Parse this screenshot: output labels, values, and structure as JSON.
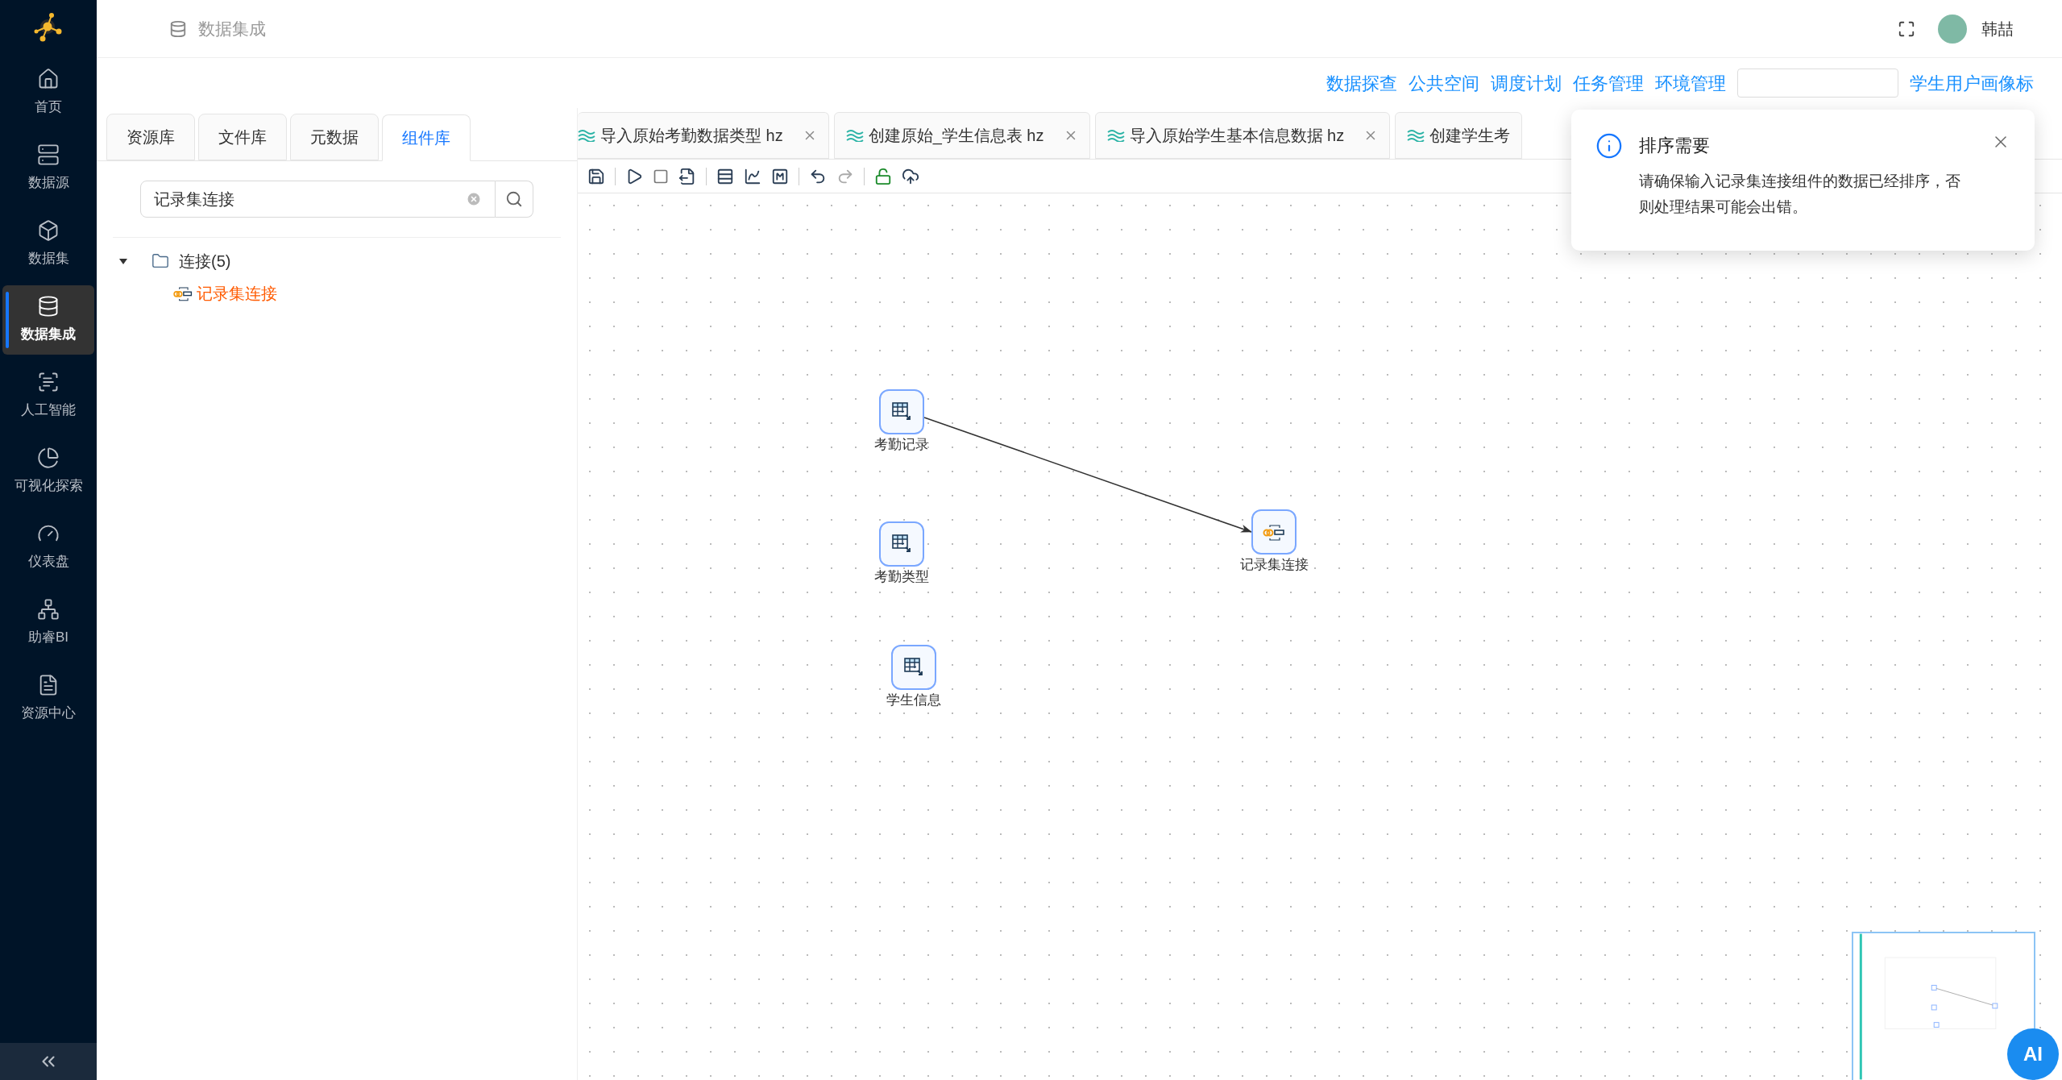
{
  "sidebar": {
    "items": [
      {
        "label": "首页",
        "selected": false
      },
      {
        "label": "数据源",
        "selected": false
      },
      {
        "label": "数据集",
        "selected": false
      },
      {
        "label": "数据集成",
        "selected": true
      },
      {
        "label": "人工智能",
        "selected": false
      },
      {
        "label": "可视化探索",
        "selected": false
      },
      {
        "label": "仪表盘",
        "selected": false
      },
      {
        "label": "助睿BI",
        "selected": false
      },
      {
        "label": "资源中心",
        "selected": false
      }
    ]
  },
  "header": {
    "title": "数据集成",
    "user": "韩喆"
  },
  "top_links": [
    "数据探查",
    "公共空间",
    "调度计划",
    "任务管理",
    "环境管理"
  ],
  "top_right_text": "学生用户画像标",
  "panel_tabs": [
    {
      "label": "资源库",
      "selected": false
    },
    {
      "label": "文件库",
      "selected": false
    },
    {
      "label": "元数据",
      "selected": false
    },
    {
      "label": "组件库",
      "selected": true
    }
  ],
  "search": {
    "value": "记录集连接"
  },
  "tree": [
    {
      "label": "连接(5)",
      "expanded": true,
      "children": [
        {
          "label": "记录集连接",
          "selected": true
        }
      ]
    }
  ],
  "doc_tabs": [
    {
      "label": "导入原始考勤数据类型 hz",
      "closable": true
    },
    {
      "label": "创建原始_学生信息表 hz",
      "closable": true
    },
    {
      "label": "导入原始学生基本信息数据 hz",
      "closable": true
    },
    {
      "label": "创建学生考",
      "closable": false
    }
  ],
  "canvas": {
    "nodes": [
      {
        "label": "考勤记录",
        "kind": "table"
      },
      {
        "label": "考勤类型",
        "kind": "table"
      },
      {
        "label": "学生信息",
        "kind": "table"
      },
      {
        "label": "记录集连接",
        "kind": "join"
      }
    ]
  },
  "notification": {
    "title": "排序需要",
    "message": "请确保输入记录集连接组件的数据已经排序，否则处理结果可能会出错。"
  },
  "ai_button": "AI"
}
